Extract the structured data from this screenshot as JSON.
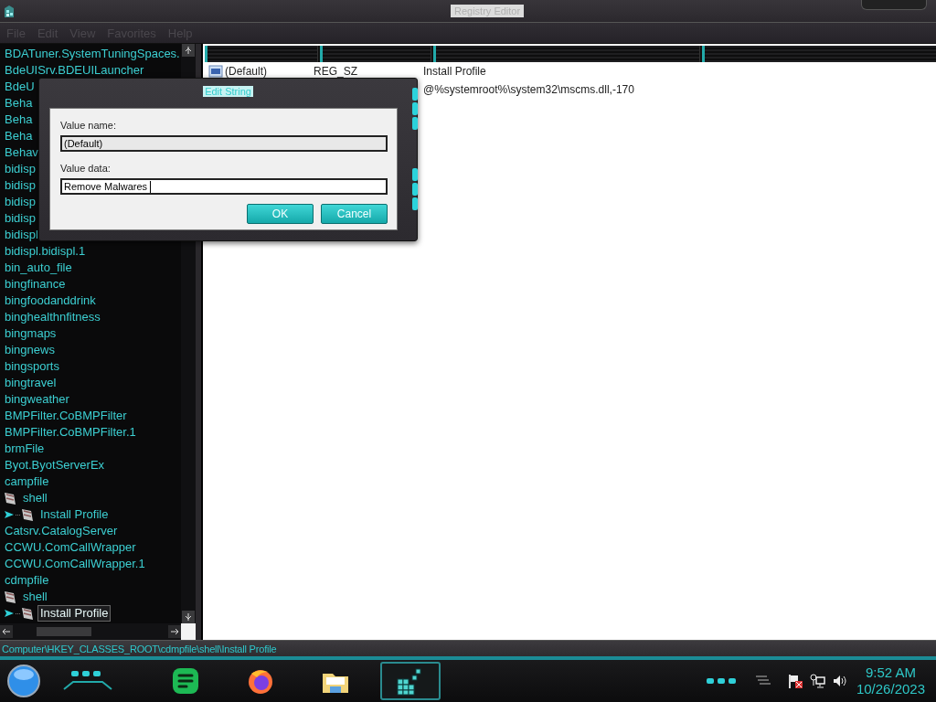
{
  "window": {
    "title": "Registry Editor"
  },
  "menu": [
    {
      "label": "File"
    },
    {
      "label": "Edit"
    },
    {
      "label": "View"
    },
    {
      "label": "Favorites"
    },
    {
      "label": "Help"
    }
  ],
  "tree": [
    {
      "label": "BDATuner.SystemTuningSpaces.",
      "selected": false
    },
    {
      "label": "BdeUISrv.BDEUILauncher",
      "selected": false
    },
    {
      "label": "BdeU",
      "selected": false
    },
    {
      "label": "Beha",
      "selected": false
    },
    {
      "label": "Beha",
      "selected": false
    },
    {
      "label": "Beha",
      "selected": false
    },
    {
      "label": "Behav",
      "selected": false
    },
    {
      "label": "bidisp",
      "selected": false
    },
    {
      "label": "bidisp",
      "selected": false
    },
    {
      "label": "bidisp",
      "selected": false
    },
    {
      "label": "bidisp",
      "selected": false
    },
    {
      "label": "bidispl",
      "selected": false
    },
    {
      "label": "bidispl.bidispl.1",
      "selected": false
    },
    {
      "label": "bin_auto_file",
      "selected": false
    },
    {
      "label": "bingfinance",
      "selected": false
    },
    {
      "label": "bingfoodanddrink",
      "selected": false
    },
    {
      "label": "binghealthnfitness",
      "selected": false
    },
    {
      "label": "bingmaps",
      "selected": false
    },
    {
      "label": "bingnews",
      "selected": false
    },
    {
      "label": "bingsports",
      "selected": false
    },
    {
      "label": "bingtravel",
      "selected": false
    },
    {
      "label": "bingweather",
      "selected": false
    },
    {
      "label": "BMPFilter.CoBMPFilter",
      "selected": false
    },
    {
      "label": "BMPFilter.CoBMPFilter.1",
      "selected": false
    },
    {
      "label": "brmFile",
      "selected": false
    },
    {
      "label": "Byot.ByotServerEx",
      "selected": false
    },
    {
      "label": "campfile",
      "selected": false,
      "children": [
        {
          "label": "shell",
          "selected": false,
          "children": [
            {
              "label": "Install Profile",
              "selected": false
            }
          ]
        }
      ]
    },
    {
      "label": "Catsrv.CatalogServer",
      "selected": false
    },
    {
      "label": "CCWU.ComCallWrapper",
      "selected": false
    },
    {
      "label": "CCWU.ComCallWrapper.1",
      "selected": false
    },
    {
      "label": "cdmpfile",
      "selected": false,
      "children": [
        {
          "label": "shell",
          "selected": false,
          "children": [
            {
              "label": "Install Profile",
              "selected": true
            }
          ]
        }
      ]
    }
  ],
  "list": {
    "rows": [
      {
        "name": "(Default)",
        "type": "REG_SZ",
        "data": "Install Profile"
      },
      {
        "data": "@%systemroot%\\system32\\mscms.dll,-170"
      }
    ]
  },
  "dialog": {
    "title": "Edit String",
    "fields": [
      {
        "label": "Value name:",
        "value": "(Default)",
        "disabled": true
      },
      {
        "label": "Value data:",
        "value": "Remove Malwares",
        "disabled": false
      }
    ],
    "buttons": [
      "OK",
      "Cancel"
    ]
  },
  "status_bar": "Computer\\HKEY_CLASSES_ROOT\\cdmpfile\\shell\\Install Profile",
  "taskbar": {
    "apps": [
      {
        "kind": "notes",
        "active": false
      },
      {
        "kind": "browser",
        "active": false
      },
      {
        "kind": "folder",
        "active": false
      },
      {
        "kind": "registry",
        "active": true
      }
    ],
    "clock": {
      "time": "9:52 AM",
      "date": "10/26/2023"
    }
  }
}
